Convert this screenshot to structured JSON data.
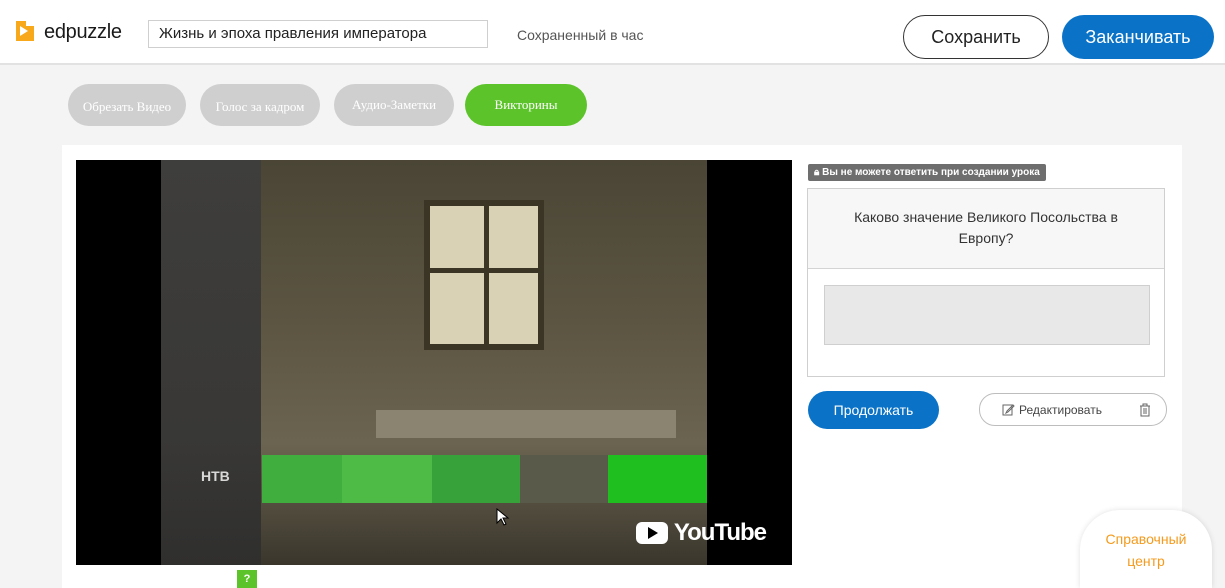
{
  "header": {
    "brand": "edpuzzle",
    "title_value": "Жизнь и эпоха правления императора",
    "saved_status": "Сохраненный в час",
    "save_label": "Сохранить",
    "finish_label": "Заканчивать",
    "accent_color": "#0a73c8"
  },
  "tools": [
    {
      "label": "Обрезать Видео",
      "active": false
    },
    {
      "label": "Голос за кадром",
      "active": false
    },
    {
      "label": "Аудио-Заметки",
      "active": false
    },
    {
      "label": "Викторины",
      "active": true
    }
  ],
  "video": {
    "watermark": "YouTube",
    "channel_logo": "НТВ"
  },
  "question": {
    "lock_notice": "Вы не можете ответить при создании урока",
    "text": "Каково значение Великого Посольства в Европу?",
    "answer_value": "",
    "continue_label": "Продолжать",
    "edit_label": "Редактировать"
  },
  "help": {
    "line1": "Справочный",
    "line2": "центр"
  },
  "timeline": {
    "marker_label": "?"
  }
}
